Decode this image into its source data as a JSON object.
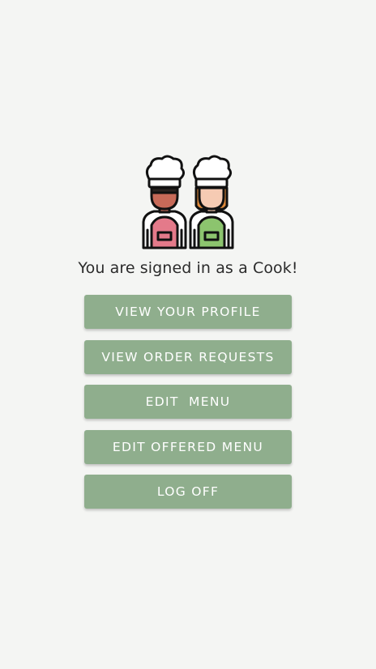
{
  "status_text": "You are signed in as a Cook!",
  "buttons": {
    "view_profile": "VIEW YOUR PROFILE",
    "view_orders": "VIEW ORDER REQUESTS",
    "edit_menu": "EDIT  MENU",
    "edit_offered_menu": "EDIT OFFERED MENU",
    "log_off": "LOG OFF"
  },
  "colors": {
    "background": "#f4f5f3",
    "button": "#8fae8d",
    "button_text": "#ffffff",
    "text": "#2b2b2b"
  },
  "icon": "two-cooks-icon"
}
